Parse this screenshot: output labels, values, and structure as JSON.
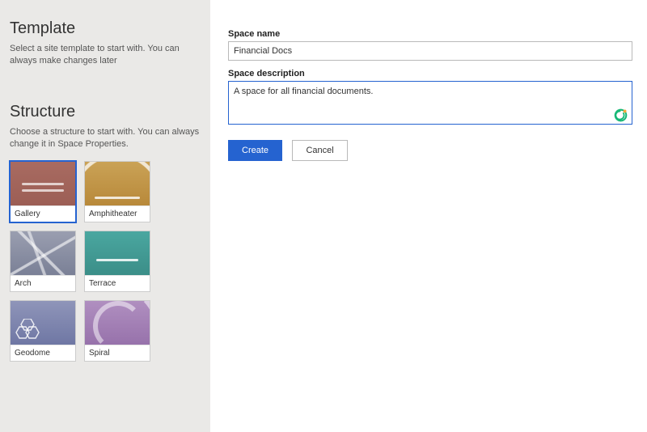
{
  "sidebar": {
    "template": {
      "heading": "Template",
      "sub": "Select a site template to start with. You can always make changes later"
    },
    "structure": {
      "heading": "Structure",
      "sub": "Choose a structure to start with. You can always change it in Space Properties.",
      "items": [
        {
          "label": "Gallery",
          "selected": true
        },
        {
          "label": "Amphitheater",
          "selected": false
        },
        {
          "label": "Arch",
          "selected": false
        },
        {
          "label": "Terrace",
          "selected": false
        },
        {
          "label": "Geodome",
          "selected": false
        },
        {
          "label": "Spiral",
          "selected": false
        }
      ]
    }
  },
  "form": {
    "name_label": "Space name",
    "name_value": "Financial Docs",
    "desc_label": "Space description",
    "desc_value": "A space for all financial documents.",
    "create_label": "Create",
    "cancel_label": "Cancel"
  }
}
